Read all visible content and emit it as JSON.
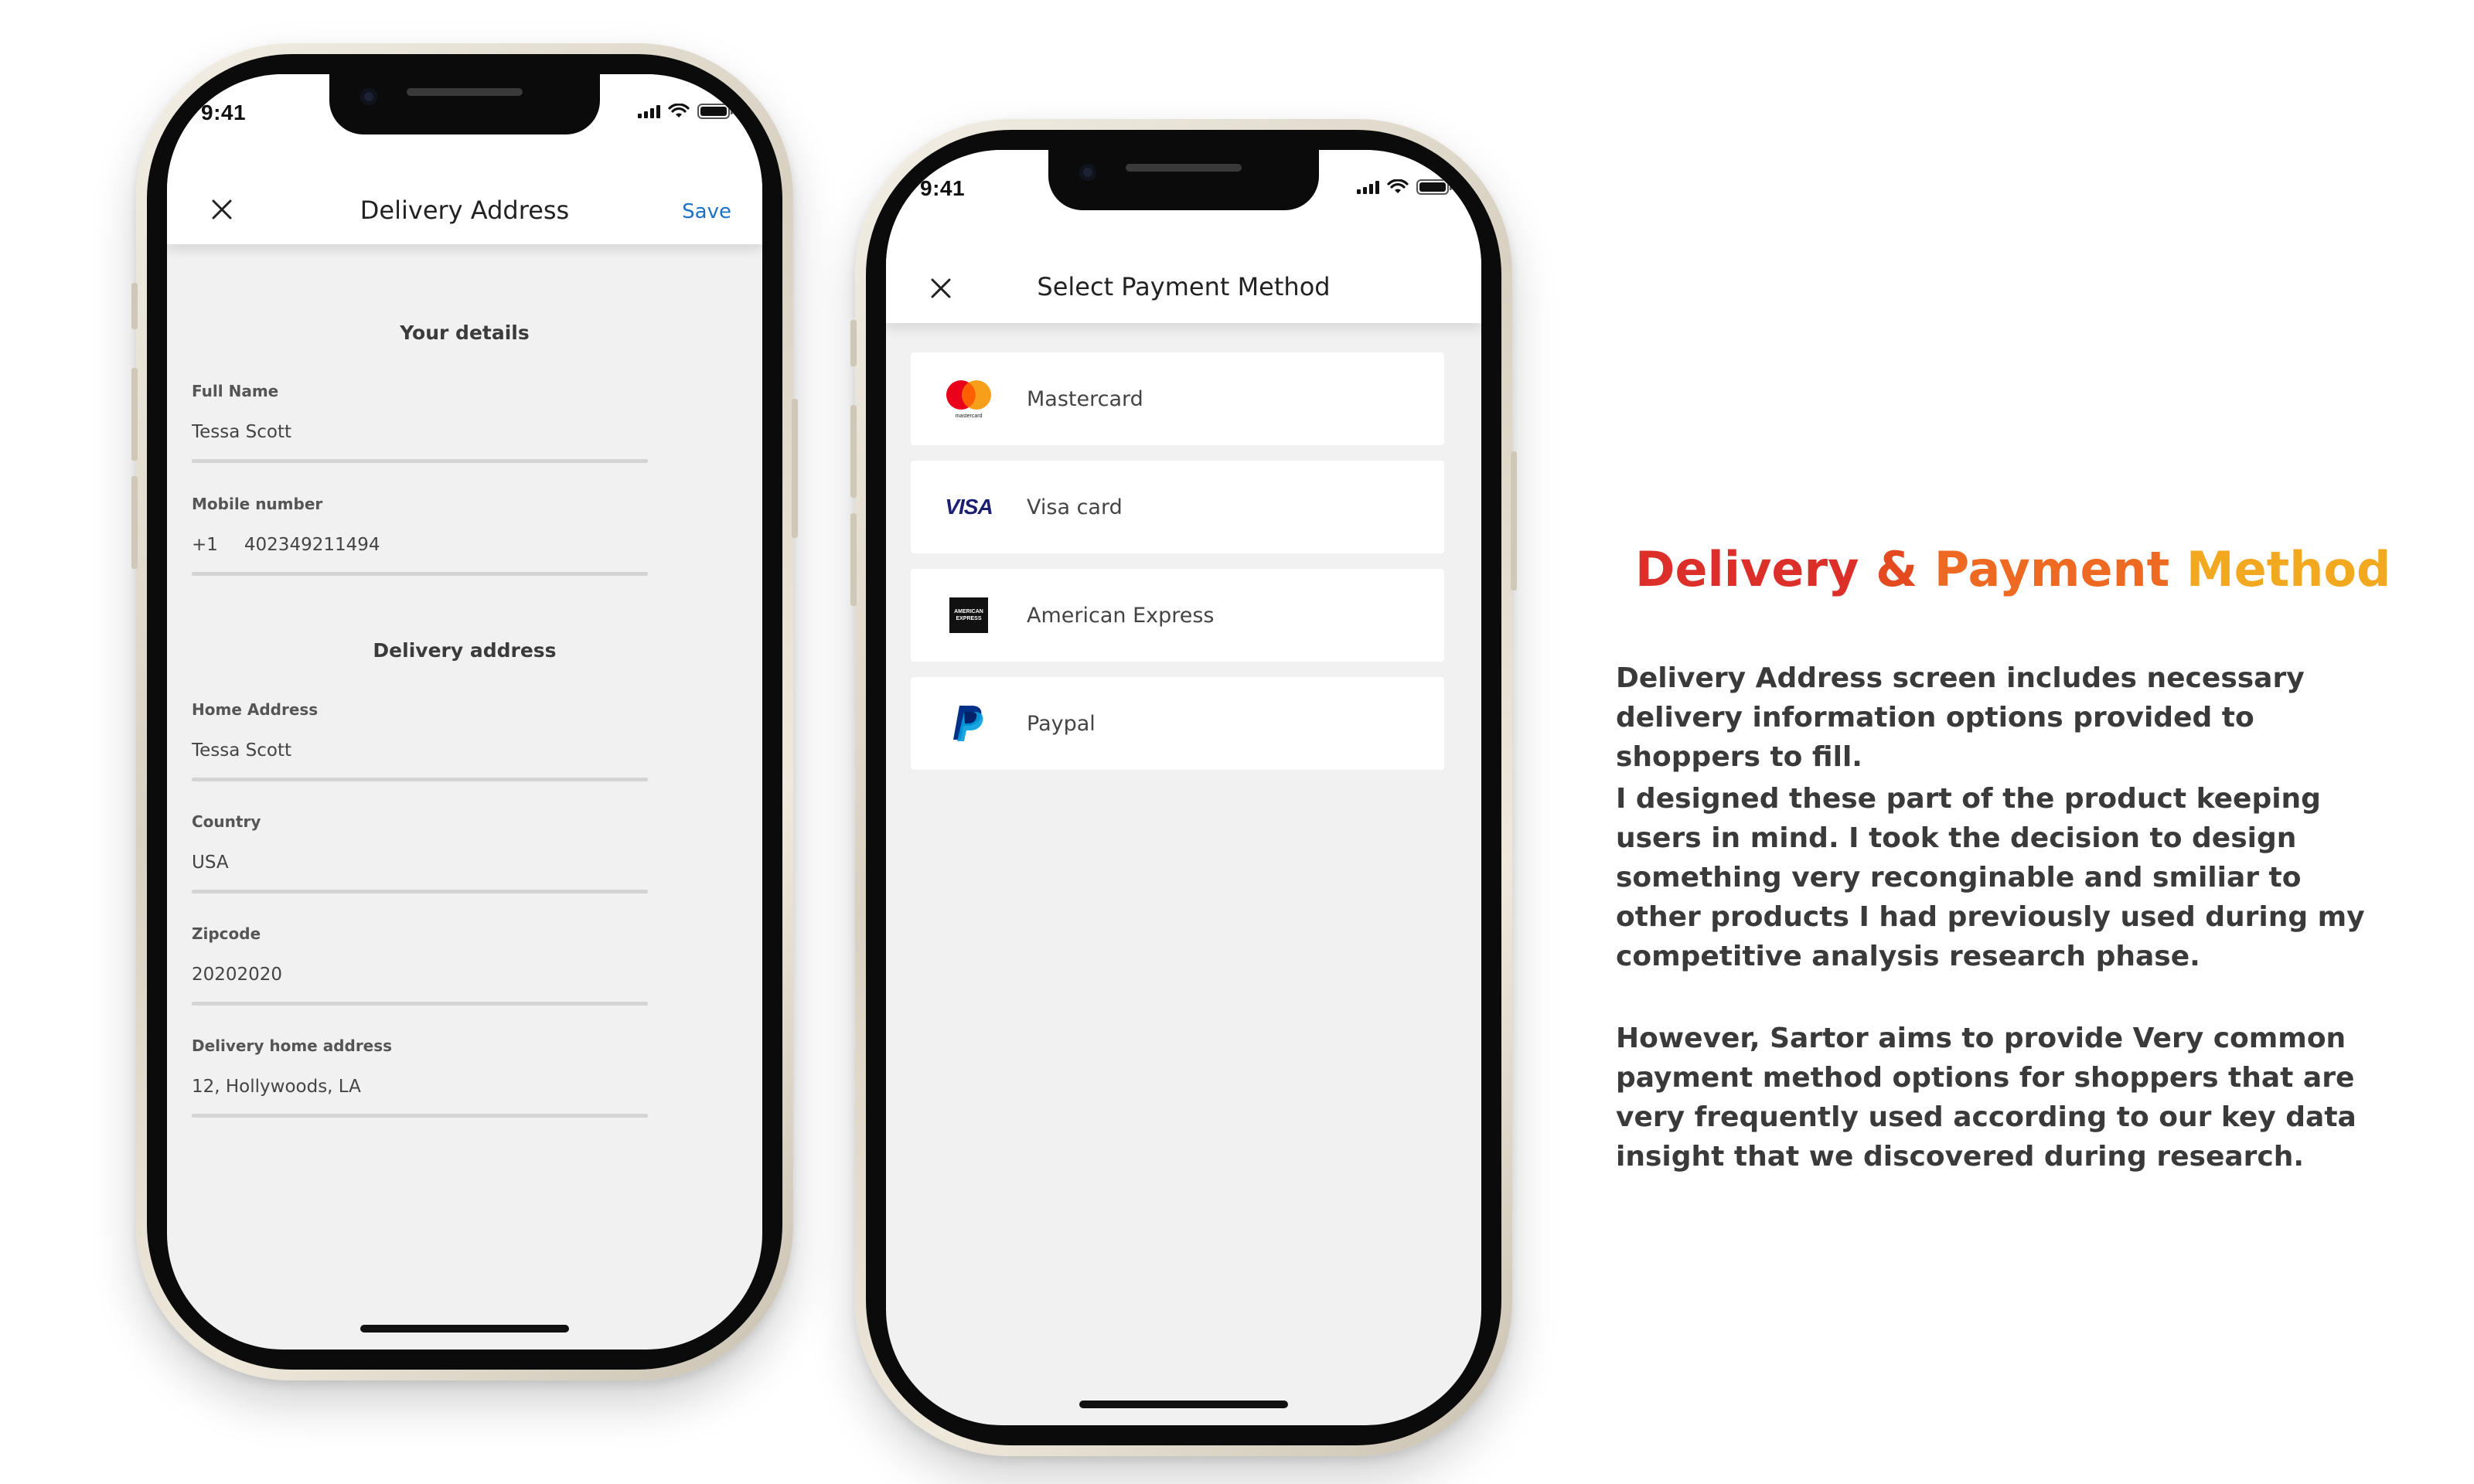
{
  "phone1": {
    "status_time": "9:41",
    "header": {
      "title": "Delivery Address",
      "save_label": "Save"
    },
    "sections": {
      "your_details": "Your details",
      "delivery_address": "Delivery address"
    },
    "fields": {
      "full_name": {
        "label": "Full Name",
        "value": "Tessa Scott"
      },
      "mobile": {
        "label": "Mobile number",
        "code": "+1",
        "value": "402349211494"
      },
      "home_address": {
        "label": "Home Address",
        "value": "Tessa Scott"
      },
      "country": {
        "label": "Country",
        "value": "USA"
      },
      "zipcode": {
        "label": "Zipcode",
        "value": "20202020"
      },
      "delivery_home_address": {
        "label": "Delivery home address",
        "value": "12, Hollywoods, LA"
      }
    }
  },
  "phone2": {
    "status_time": "9:41",
    "header": {
      "title": "Select Payment Method"
    },
    "methods": [
      {
        "name": "Mastercard",
        "icon": "mastercard-icon"
      },
      {
        "name": "Visa card",
        "icon": "visa-icon"
      },
      {
        "name": "American Express",
        "icon": "american-express-icon"
      },
      {
        "name": "Paypal",
        "icon": "paypal-icon"
      }
    ],
    "logo_text": {
      "mastercard": "mastercard",
      "visa": "VISA",
      "amex_top": "AMERICAN",
      "amex_bottom": "EXPRESS"
    }
  },
  "panel": {
    "headline_part1": "Delivery",
    "headline_amp": "&",
    "headline_part2": "Payment",
    "headline_part3": "Method",
    "paragraphs": [
      "Delivery Address screen includes necessary delivery information options provided to shoppers to fill.",
      "I designed these part of the product keeping users in mind. I took the decision to design something very reconginable and smiliar to other products I had previously used during my competitive analysis research phase.",
      "However, Sartor aims to provide Very common payment method options for shoppers that are very frequently used according to our key data insight that we discovered during research."
    ]
  },
  "colors": {
    "headline_red": "#dd2f2a",
    "headline_orange": "#ee6a22",
    "headline_yellow": "#f2a81f",
    "save_blue": "#1a73c9",
    "screen_bg": "#f1f1f1"
  }
}
